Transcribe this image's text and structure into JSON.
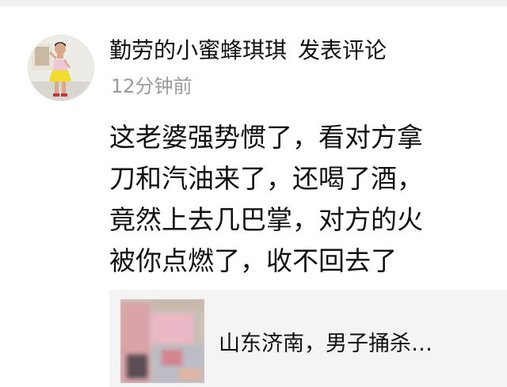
{
  "comment": {
    "author_name": "勤劳的小蜜蜂琪琪",
    "action_label": "发表评论",
    "time_ago": "12分钟前",
    "text_lines": [
      "这老婆强势惯了，看对方拿",
      "刀和汽油来了，还喝了酒，",
      "竟然上去几巴掌，对方的火",
      "被你点燃了，收不回去了"
    ]
  },
  "article": {
    "title": "山东济南，男子捅杀…"
  }
}
